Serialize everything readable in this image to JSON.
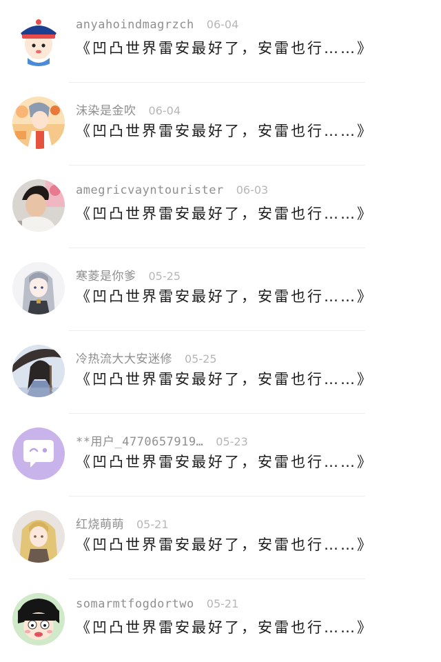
{
  "comments": [
    {
      "username": "anyahoindmagrzch",
      "date": "06-04",
      "text": "《凹凸世界雷安最好了，安雷也行……》",
      "avatar": "qing-official-avatar"
    },
    {
      "username": "沫染是金吹",
      "date": "06-04",
      "text": "《凹凸世界雷安最好了，安雷也行……》",
      "avatar": "anime-boy-avatar"
    },
    {
      "username": "amegricvayntourister",
      "date": "06-03",
      "text": "《凹凸世界雷安最好了，安雷也行……》",
      "avatar": "photo-boy-avatar"
    },
    {
      "username": "寒菱是你爹",
      "date": "05-25",
      "text": "《凹凸世界雷安最好了，安雷也行……》",
      "avatar": "silver-hair-girl-avatar"
    },
    {
      "username": "冷热流大大安迷修",
      "date": "05-25",
      "text": "《凹凸世界雷安最好了，安雷也行……》",
      "avatar": "umbrella-swordsman-avatar"
    },
    {
      "username": "**用户_4770657919…",
      "date": "05-23",
      "text": "《凹凸世界雷安最好了，安雷也行……》",
      "avatar": "default-chat-bubble-avatar"
    },
    {
      "username": "红烧萌萌",
      "date": "05-21",
      "text": "《凹凸世界雷安最好了，安雷也行……》",
      "avatar": "blonde-girl-avatar"
    },
    {
      "username": "somarmtfogdortwo",
      "date": "05-21",
      "text": "《凹凸世界雷安最好了，安雷也行……》",
      "avatar": "maruko-avatar"
    }
  ]
}
